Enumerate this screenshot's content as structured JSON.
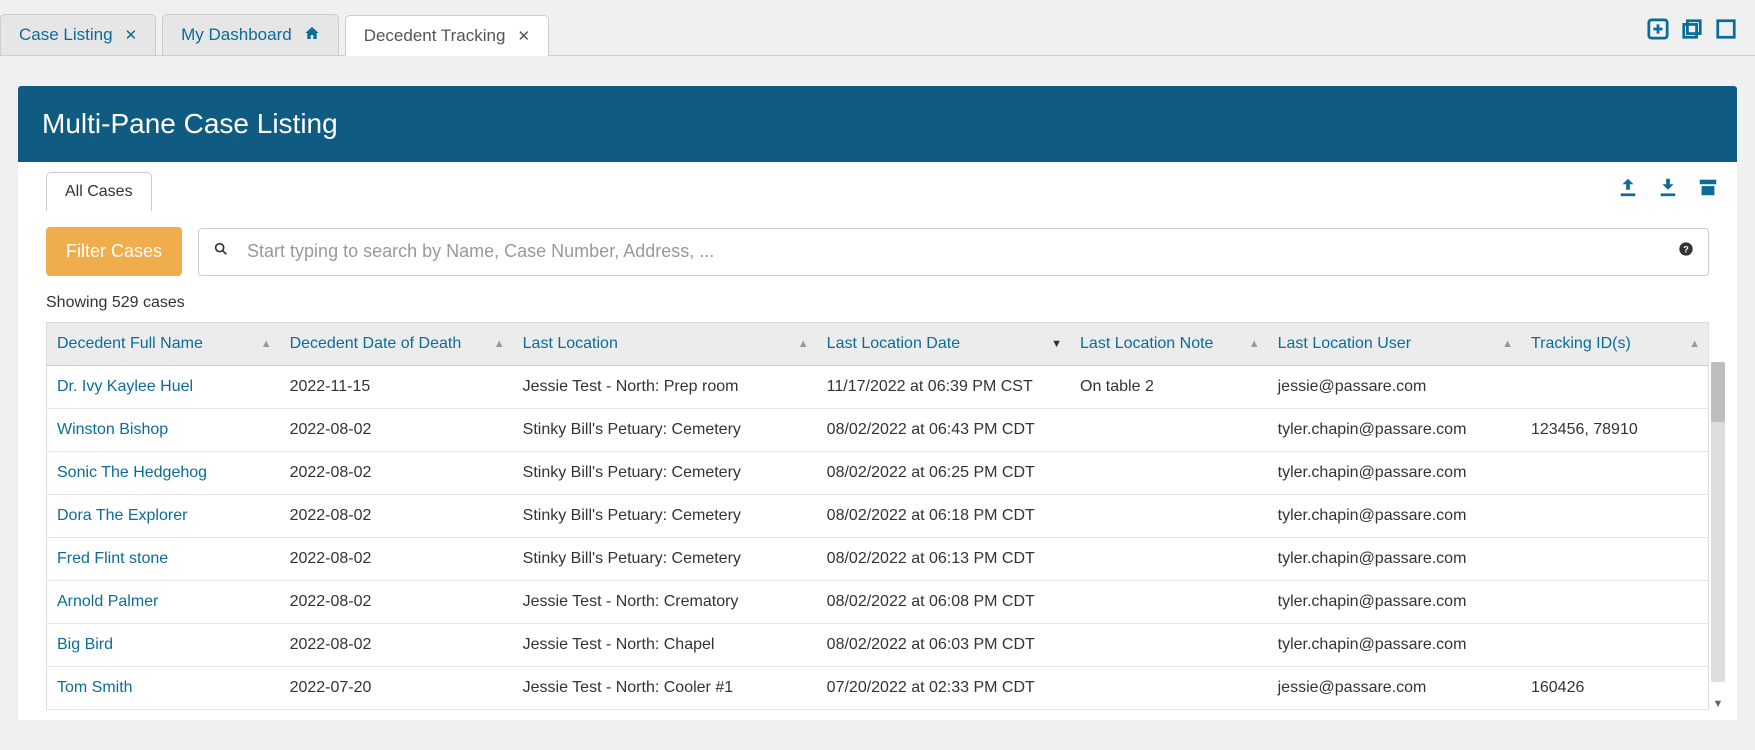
{
  "tabs": [
    {
      "label": "Case Listing",
      "icon": "close"
    },
    {
      "label": "My Dashboard",
      "icon": "home"
    },
    {
      "label": "Decedent Tracking",
      "icon": "close",
      "active": true
    }
  ],
  "banner_title": "Multi-Pane Case Listing",
  "sub_tab": "All Cases",
  "filter_button": "Filter Cases",
  "search_placeholder": "Start typing to search by Name, Case Number, Address, ...",
  "showing_text": "Showing 529 cases",
  "columns": [
    "Decedent Full Name",
    "Decedent Date of Death",
    "Last Location",
    "Last Location Date",
    "Last Location Note",
    "Last Location User",
    "Tracking ID(s)"
  ],
  "rows": [
    {
      "name": "Dr. Ivy Kaylee Huel",
      "dod": "2022-11-15",
      "loc": "Jessie Test - North: Prep room",
      "locdate": "11/17/2022 at 06:39 PM CST",
      "note": "On table 2",
      "user": "jessie@passare.com",
      "tracking": ""
    },
    {
      "name": "Winston Bishop",
      "dod": "2022-08-02",
      "loc": "Stinky Bill's Petuary: Cemetery",
      "locdate": "08/02/2022 at 06:43 PM CDT",
      "note": "",
      "user": "tyler.chapin@passare.com",
      "tracking": "123456, 78910"
    },
    {
      "name": "Sonic The Hedgehog",
      "dod": "2022-08-02",
      "loc": "Stinky Bill's Petuary: Cemetery",
      "locdate": "08/02/2022 at 06:25 PM CDT",
      "note": "",
      "user": "tyler.chapin@passare.com",
      "tracking": ""
    },
    {
      "name": "Dora The Explorer",
      "dod": "2022-08-02",
      "loc": "Stinky Bill's Petuary: Cemetery",
      "locdate": "08/02/2022 at 06:18 PM CDT",
      "note": "",
      "user": "tyler.chapin@passare.com",
      "tracking": ""
    },
    {
      "name": "Fred Flint stone",
      "dod": "2022-08-02",
      "loc": "Stinky Bill's Petuary: Cemetery",
      "locdate": "08/02/2022 at 06:13 PM CDT",
      "note": "",
      "user": "tyler.chapin@passare.com",
      "tracking": ""
    },
    {
      "name": "Arnold Palmer",
      "dod": "2022-08-02",
      "loc": "Jessie Test - North: Crematory",
      "locdate": "08/02/2022 at 06:08 PM CDT",
      "note": "",
      "user": "tyler.chapin@passare.com",
      "tracking": ""
    },
    {
      "name": "Big Bird",
      "dod": "2022-08-02",
      "loc": "Jessie Test - North: Chapel",
      "locdate": "08/02/2022 at 06:03 PM CDT",
      "note": "",
      "user": "tyler.chapin@passare.com",
      "tracking": ""
    },
    {
      "name": "Tom Smith",
      "dod": "2022-07-20",
      "loc": "Jessie Test - North: Cooler #1",
      "locdate": "07/20/2022 at 02:33 PM CDT",
      "note": "",
      "user": "jessie@passare.com",
      "tracking": "160426"
    }
  ]
}
